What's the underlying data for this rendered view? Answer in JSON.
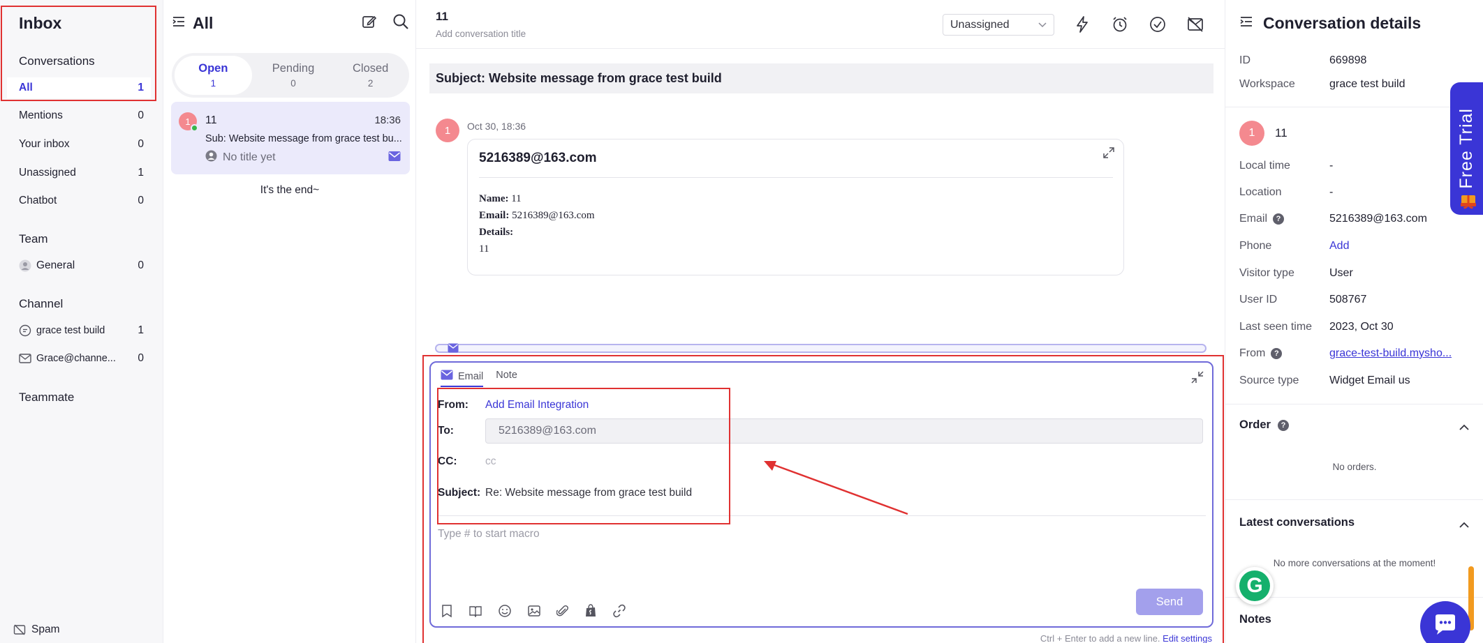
{
  "sidebar": {
    "title": "Inbox",
    "conversations_label": "Conversations",
    "items": [
      {
        "label": "All",
        "count": "1"
      },
      {
        "label": "Mentions",
        "count": "0"
      },
      {
        "label": "Your inbox",
        "count": "0"
      },
      {
        "label": "Unassigned",
        "count": "1"
      },
      {
        "label": "Chatbot",
        "count": "0"
      }
    ],
    "team_label": "Team",
    "team_items": [
      {
        "label": "General",
        "count": "0"
      }
    ],
    "channel_label": "Channel",
    "channel_items": [
      {
        "label": "grace test build",
        "count": "1"
      },
      {
        "label": "Grace@channe...",
        "count": "0"
      }
    ],
    "teammate_label": "Teammate",
    "spam_label": "Spam"
  },
  "list": {
    "title": "All",
    "tabs": [
      {
        "label": "Open",
        "count": "1"
      },
      {
        "label": "Pending",
        "count": "0"
      },
      {
        "label": "Closed",
        "count": "2"
      }
    ],
    "card": {
      "avatar_initial": "1",
      "name": "11",
      "time": "18:36",
      "subject": "Sub: Website message from grace test bu...",
      "title_placeholder": "No title yet"
    },
    "end_text": "It's the end~"
  },
  "main": {
    "conv_number": "11",
    "add_title": "Add conversation title",
    "assignee": "Unassigned",
    "subject": "Subject: Website message from grace test build",
    "message": {
      "avatar_initial": "1",
      "timestamp": "Oct 30, 18:36",
      "sender": "5216389@163.com",
      "name_label": "Name:",
      "name_value": " 11",
      "email_label": "Email:",
      "email_value": " 5216389@163.com",
      "details_label": "Details:",
      "details_value": "11"
    },
    "composer": {
      "tab_email": "Email",
      "tab_note": "Note",
      "from_label": "From:",
      "from_value": "Add Email Integration",
      "to_label": "To:",
      "to_value": "5216389@163.com",
      "cc_label": "CC:",
      "cc_placeholder": "cc",
      "subject_label": "Subject:",
      "subject_value": "Re: Website message from grace test build",
      "body_placeholder": "Type # to start macro",
      "send_label": "Send",
      "hint": "Ctrl + Enter to add a new line.",
      "edit_settings": "Edit settings"
    }
  },
  "details": {
    "title": "Conversation details",
    "id_label": "ID",
    "id_value": "669898",
    "workspace_label": "Workspace",
    "workspace_value": "grace test build",
    "contact_initial": "1",
    "contact_name": "11",
    "rows": [
      {
        "label": "Local time",
        "value": "-"
      },
      {
        "label": "Location",
        "value": "-"
      },
      {
        "label": "Email",
        "value": "5216389@163.com"
      },
      {
        "label": "Phone",
        "value": "Add"
      },
      {
        "label": "Visitor type",
        "value": "User"
      },
      {
        "label": "User ID",
        "value": "508767"
      },
      {
        "label": "Last seen time",
        "value": "2023, Oct 30"
      },
      {
        "label": "From",
        "value": "grace-test-build.mysho..."
      },
      {
        "label": "Source type",
        "value": "Widget Email us"
      }
    ],
    "order_label": "Order",
    "no_orders": "No orders.",
    "latest_label": "Latest conversations",
    "no_more": "No more conversations at the moment!",
    "notes_label": "Notes"
  },
  "overlays": {
    "free_trial": "Free Trial",
    "grammarly_letter": "G"
  },
  "colors": {
    "accent": "#3a35d6",
    "annotation_red": "#e03131",
    "selected_bg": "#ebeafb",
    "send_disabled": "#a3a0ec"
  }
}
